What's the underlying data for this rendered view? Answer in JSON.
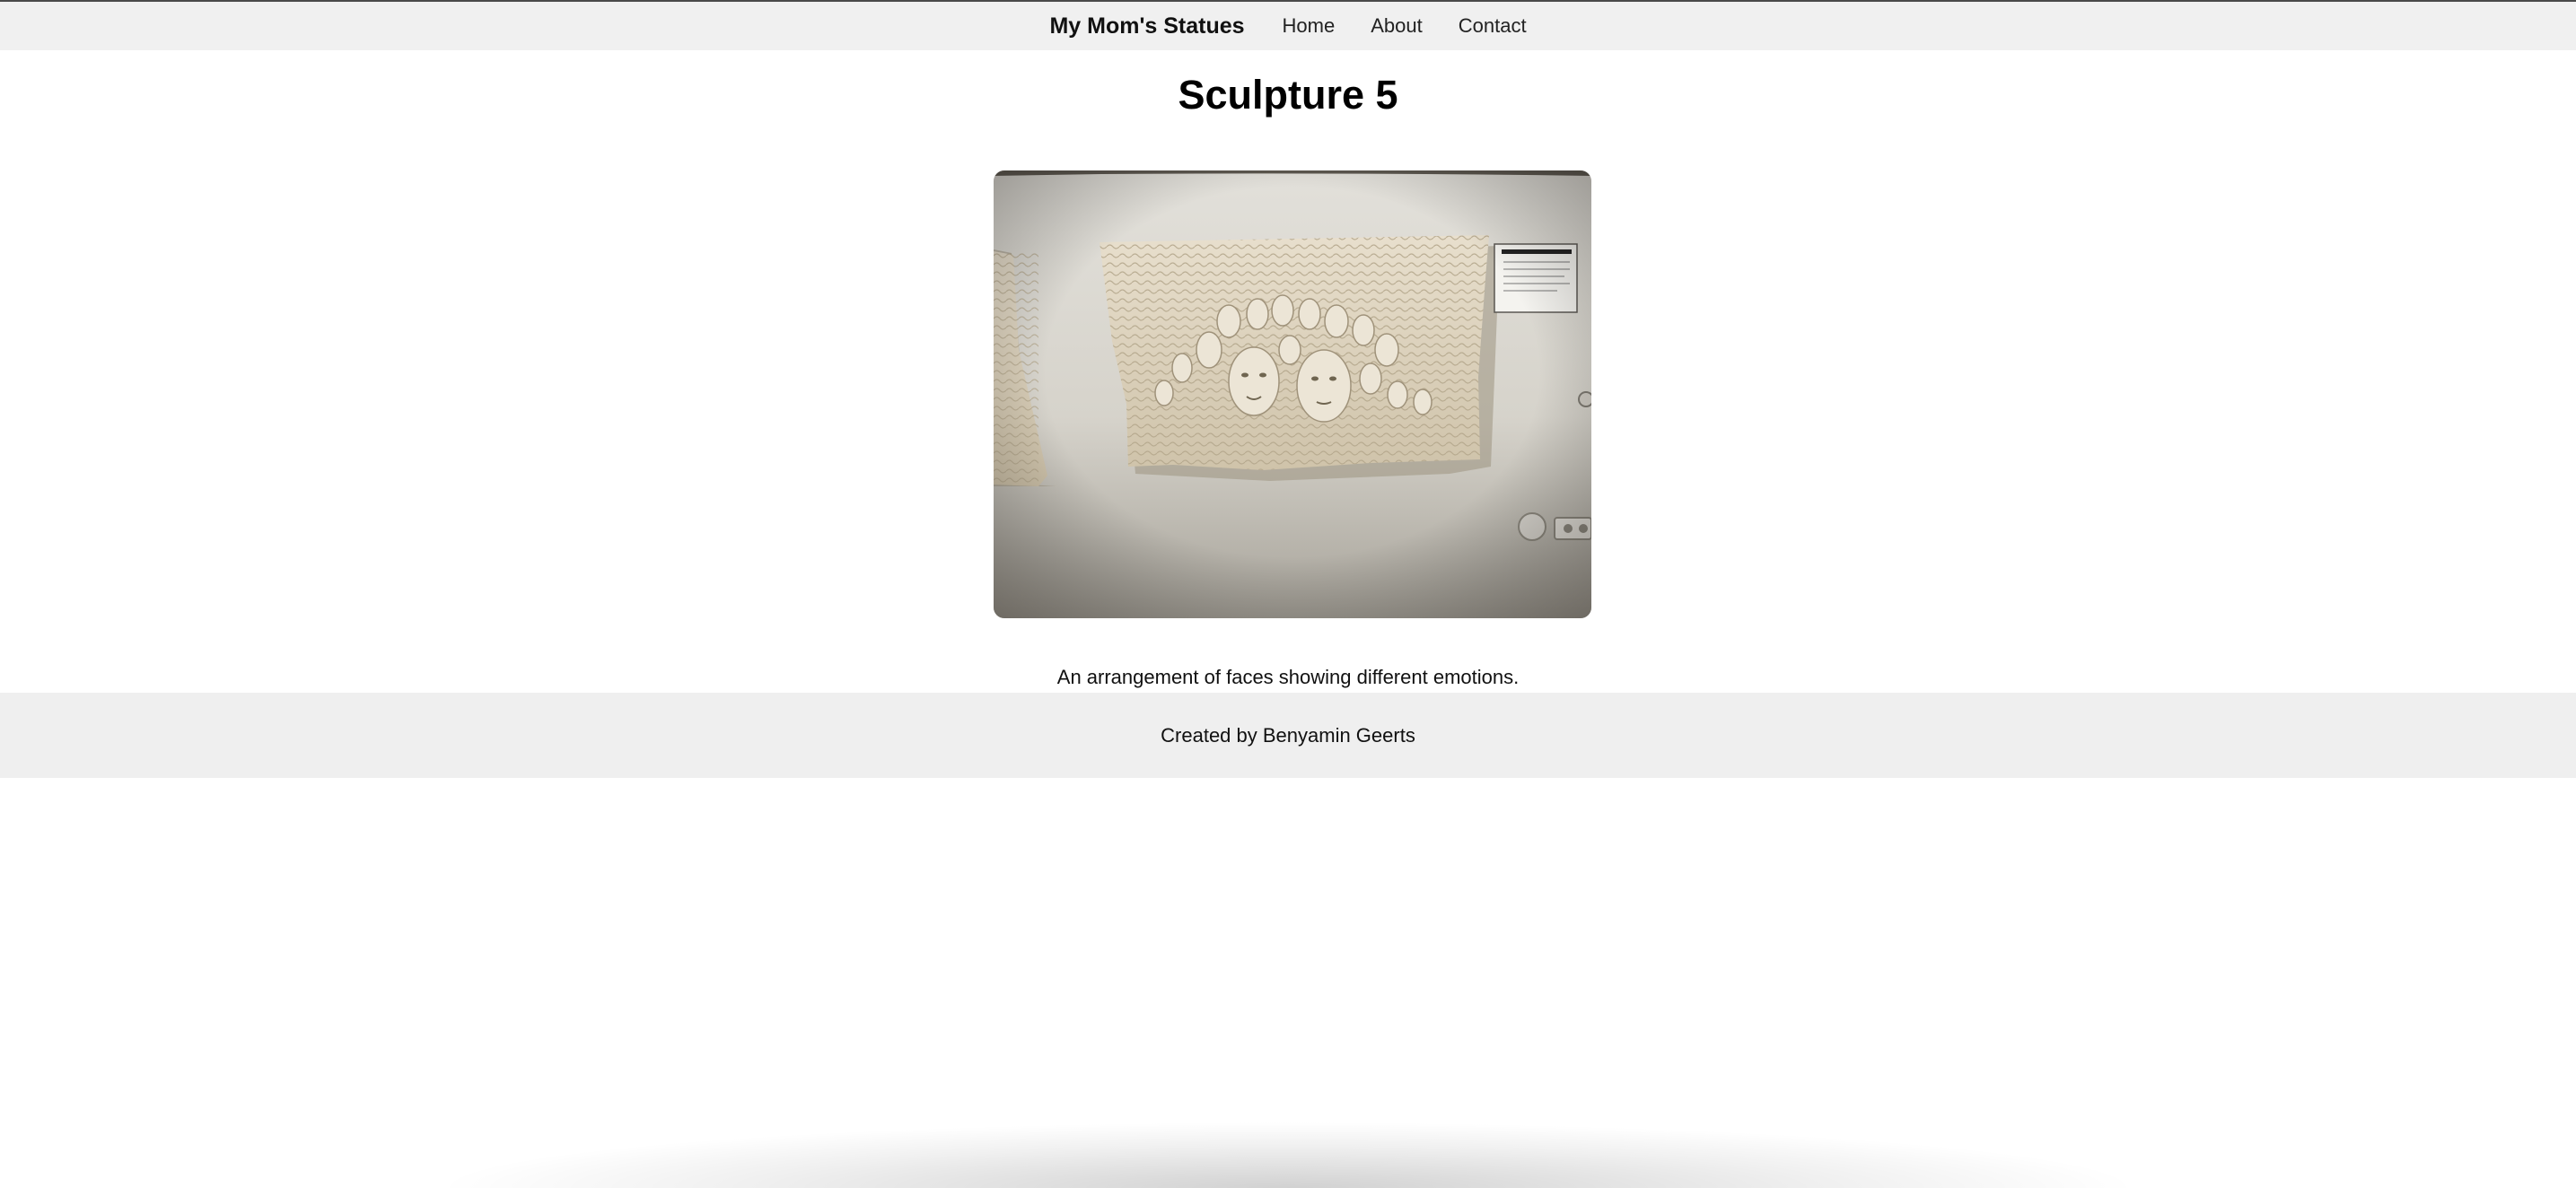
{
  "nav": {
    "brand": "My Mom's Statues",
    "links": [
      {
        "label": "Home"
      },
      {
        "label": "About"
      },
      {
        "label": "Contact"
      }
    ]
  },
  "page": {
    "title": "Sculpture 5",
    "image_alt": "Sculpture 5",
    "caption": "An arrangement of faces showing different emotions."
  },
  "footer": {
    "text": "Created by Benyamin Geerts"
  }
}
